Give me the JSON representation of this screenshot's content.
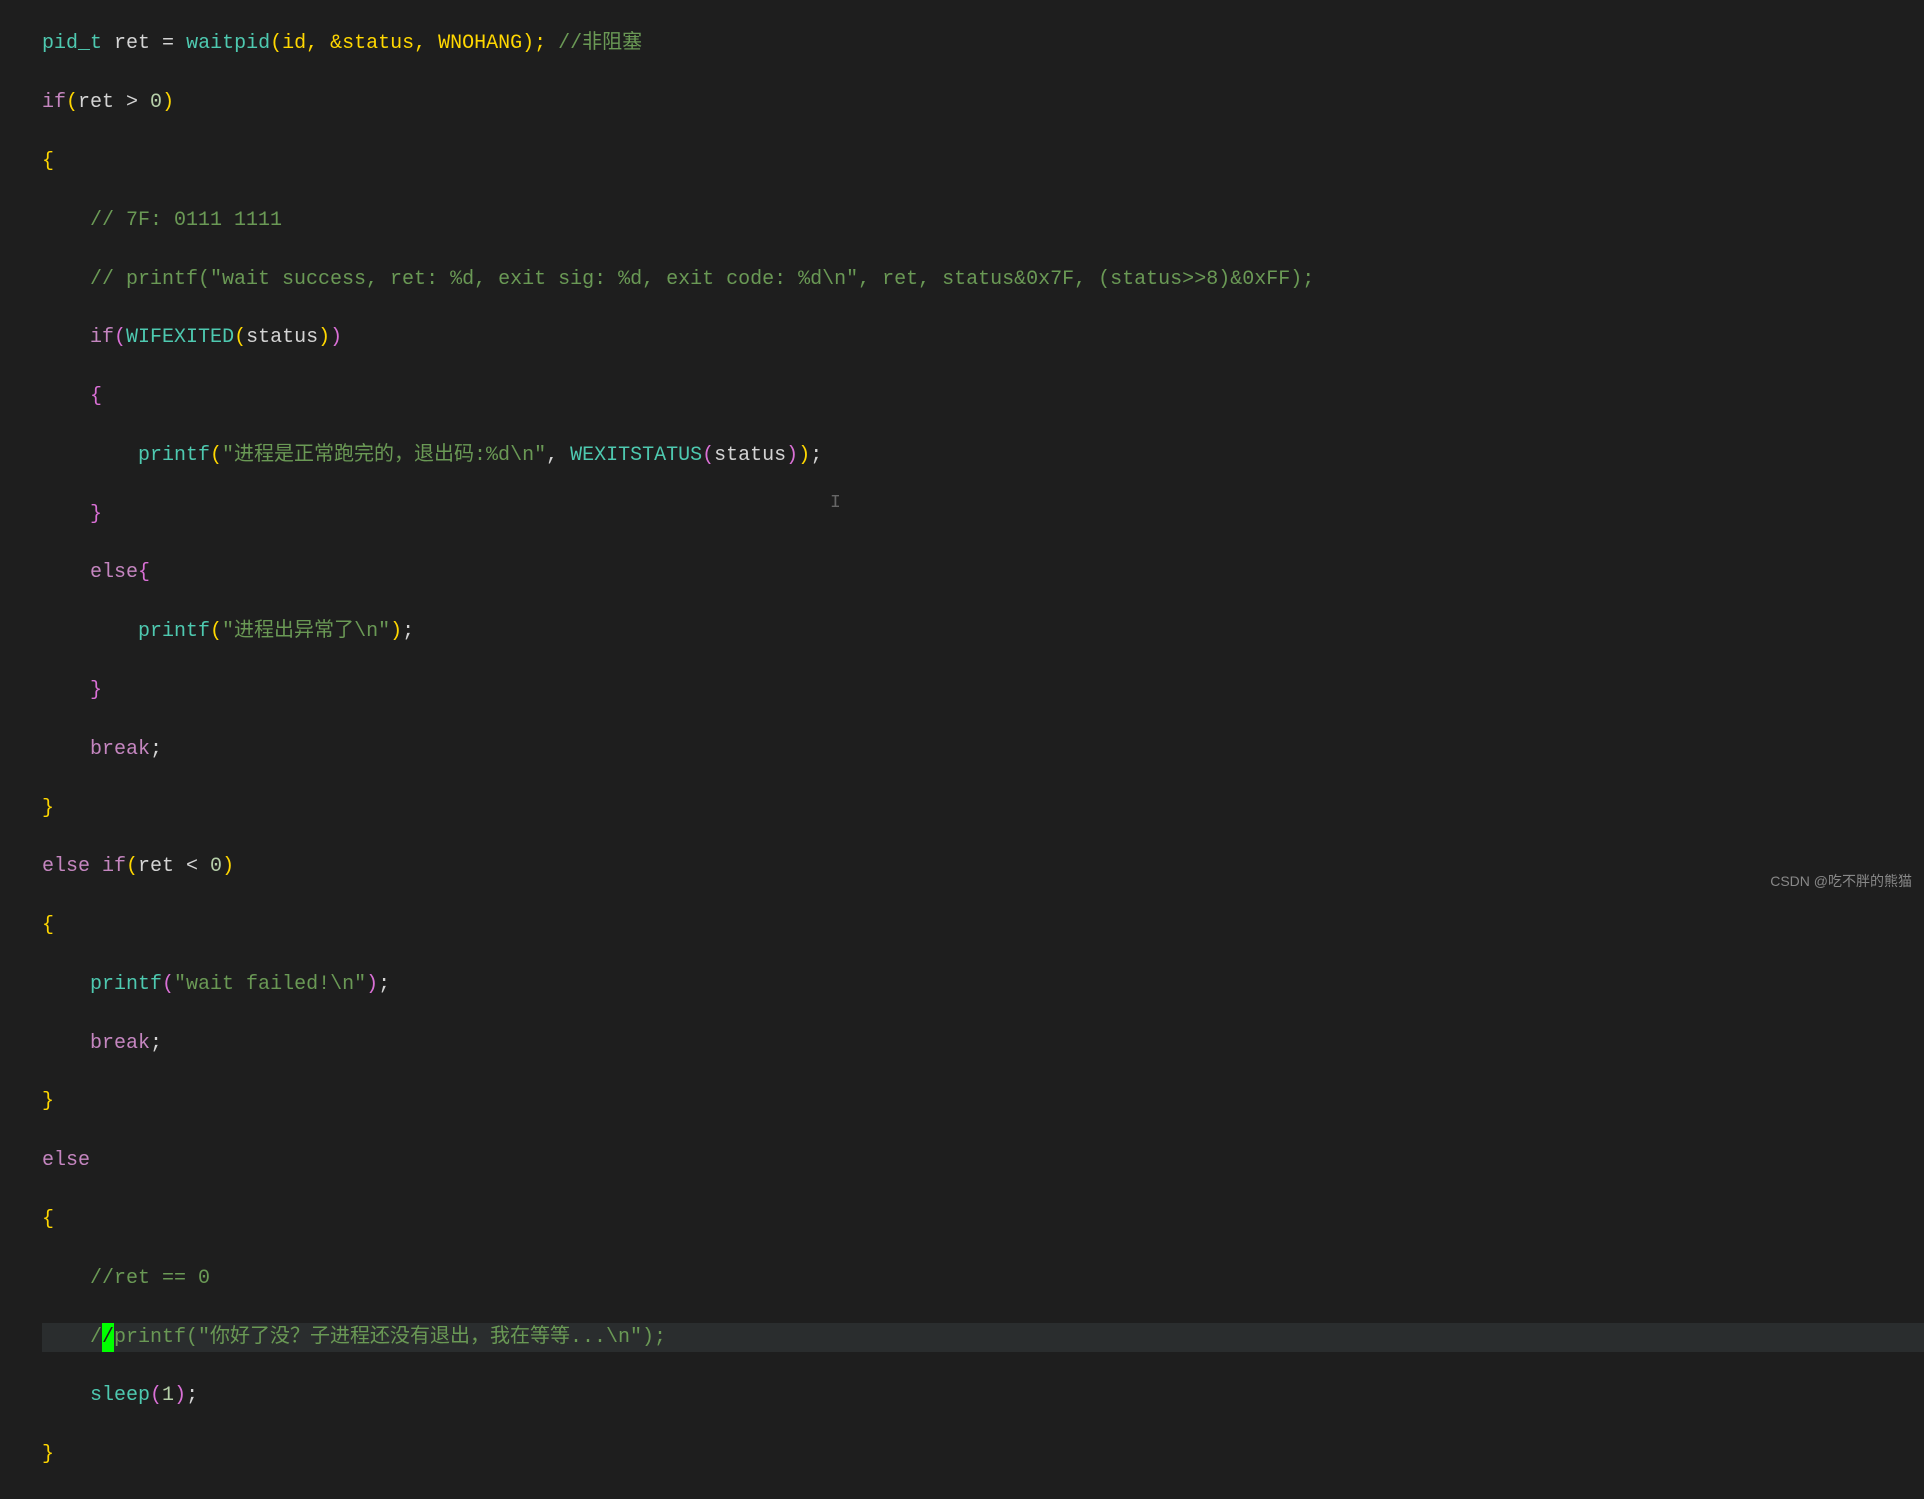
{
  "code": {
    "line1": {
      "type": "pid_t",
      "var": "ret",
      "eq": " = ",
      "func": "waitpid",
      "args": "(id, &status, WNOHANG);",
      "comment": " //非阻塞"
    },
    "line2": "if(ret > 0)",
    "line3": "{",
    "line4": "    // 7F: 0111 1111",
    "line5": "    // printf(\"wait success, ret: %d, exit sig: %d, exit code: %d\\n\", ret, status&0x7F, (status>>8)&0xFF);",
    "line6_if": "    if",
    "line6_paren_o": "(",
    "line6_func": "WIFEXITED",
    "line6_inner_o": "(",
    "line6_arg": "status",
    "line6_inner_c": ")",
    "line6_paren_c": ")",
    "line7": "    {",
    "line8_indent": "        ",
    "line8_func": "printf",
    "line8_paren_o": "(",
    "line8_str": "\"进程是正常跑完的，退出码:%d",
    "line8_esc": "\\n",
    "line8_str_end": "\"",
    "line8_comma": ", ",
    "line8_func2": "WEXITSTATUS",
    "line8_inner_o": "(",
    "line8_arg": "status",
    "line8_inner_c": ")",
    "line8_paren_c": ")",
    "line8_semi": ";",
    "line9": "    }",
    "line10": "    else{",
    "line11_indent": "        ",
    "line11_func": "printf",
    "line11_paren_o": "(",
    "line11_str": "\"进程出异常了",
    "line11_esc": "\\n",
    "line11_str_end": "\"",
    "line11_paren_c": ")",
    "line11_semi": ";",
    "line12": "    }",
    "line13_indent": "    ",
    "line13_break": "break",
    "line13_semi": ";",
    "line14": "}",
    "line15": "else if(ret < 0)",
    "line16": "{",
    "line17_indent": "    ",
    "line17_func": "printf",
    "line17_paren_o": "(",
    "line17_str": "\"wait failed!",
    "line17_esc": "\\n",
    "line17_str_end": "\"",
    "line17_paren_c": ")",
    "line17_semi": ";",
    "line18_indent": "    ",
    "line18_break": "break",
    "line18_semi": ";",
    "line19": "}",
    "line20": "else",
    "line21": "{",
    "line22": "    //ret == 0",
    "line23_indent": "    /",
    "line23_cursor": "/",
    "line23_rest": "printf(\"你好了没？子进程还没有退出，我在等等...\\n\");",
    "line24_indent": "    ",
    "line24_func": "sleep",
    "line24_paren_o": "(",
    "line24_num": "1",
    "line24_paren_c": ")",
    "line24_semi": ";",
    "line25": "}"
  },
  "watermark": "CSDN @吃不胖的熊猫"
}
